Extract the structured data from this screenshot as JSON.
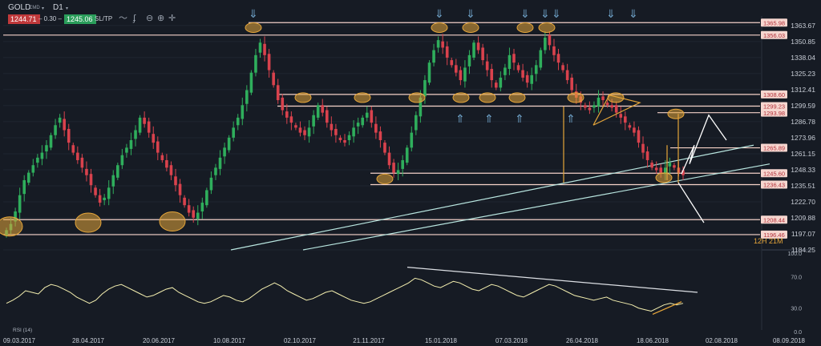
{
  "toolbar": {
    "symbol": "GOLD",
    "type": "CMD",
    "timeframe": "D1",
    "sell_price": "1244.71",
    "spread": "0.30",
    "buy_price": "1245.06",
    "sltp_label": "SL/TP"
  },
  "colors": {
    "background": "#161b24",
    "candle_up": "#2fae5c",
    "candle_down": "#d9424d",
    "level_line": "#f5d2c8",
    "trendline": "#b9e6e0",
    "rsi_line": "#f5f0b0",
    "annotation": "#e6a63a",
    "arrow_blue": "#6fa3c9"
  },
  "chart_data": [
    {
      "type": "candlestick",
      "title": "",
      "y_ticks": [
        "1363.67",
        "1350.85",
        "1338.04",
        "1325.23",
        "1312.41",
        "1299.59",
        "1286.78",
        "1273.96",
        "1261.15",
        "1248.33",
        "1235.51",
        "1222.70",
        "1209.88",
        "1197.07",
        "1184.25"
      ],
      "ylim": [
        1184.25,
        1370
      ],
      "x_ticks": [
        "09.03.2017",
        "28.04.2017",
        "20.06.2017",
        "10.08.2017",
        "02.10.2017",
        "21.11.2017",
        "15.01.2018",
        "07.03.2018",
        "26.04.2018",
        "18.06.2018",
        "02.08.2018",
        "08.09.2018"
      ],
      "level_labels": [
        "1365.98",
        "1356.03",
        "1308.60",
        "1299.23",
        "1293.98",
        "1265.89",
        "1245.60",
        "1236.43",
        "1208.44",
        "1196.46"
      ],
      "countdown": "12H 21M",
      "series_close": [
        1200,
        1205,
        1215,
        1228,
        1240,
        1246,
        1252,
        1258,
        1262,
        1268,
        1276,
        1284,
        1290,
        1280,
        1270,
        1262,
        1256,
        1250,
        1244,
        1236,
        1228,
        1222,
        1226,
        1234,
        1244,
        1252,
        1260,
        1266,
        1272,
        1280,
        1290,
        1285,
        1278,
        1270,
        1262,
        1256,
        1250,
        1244,
        1236,
        1228,
        1220,
        1214,
        1210,
        1214,
        1222,
        1232,
        1242,
        1250,
        1258,
        1266,
        1274,
        1282,
        1290,
        1300,
        1312,
        1326,
        1340,
        1350,
        1340,
        1328,
        1316,
        1304,
        1296,
        1290,
        1286,
        1282,
        1278,
        1276,
        1282,
        1292,
        1300,
        1294,
        1286,
        1280,
        1276,
        1272,
        1270,
        1276,
        1282,
        1286,
        1290,
        1294,
        1286,
        1278,
        1272,
        1262,
        1252,
        1246,
        1248,
        1256,
        1266,
        1278,
        1292,
        1306,
        1320,
        1334,
        1344,
        1352,
        1346,
        1338,
        1332,
        1326,
        1320,
        1330,
        1340,
        1350,
        1344,
        1336,
        1328,
        1320,
        1314,
        1322,
        1330,
        1340,
        1334,
        1328,
        1322,
        1318,
        1324,
        1332,
        1344,
        1354,
        1348,
        1340,
        1334,
        1328,
        1320,
        1312,
        1306,
        1302,
        1298,
        1296,
        1300,
        1306,
        1304,
        1300,
        1298,
        1294,
        1290,
        1286,
        1282,
        1278,
        1270,
        1262,
        1256,
        1250,
        1248,
        1246,
        1250,
        1254,
        1250,
        1246,
        1244
      ]
    },
    {
      "type": "line",
      "title": "",
      "indicator_label": "RSI (14)",
      "y_ticks": [
        "100.0",
        "70.0",
        "30.0",
        "0.0"
      ],
      "ylim": [
        0,
        100
      ],
      "values": [
        36,
        40,
        45,
        52,
        50,
        48,
        56,
        60,
        58,
        54,
        50,
        44,
        40,
        36,
        40,
        48,
        54,
        58,
        60,
        56,
        52,
        48,
        44,
        46,
        50,
        54,
        56,
        50,
        46,
        42,
        38,
        36,
        38,
        42,
        46,
        44,
        40,
        38,
        42,
        48,
        54,
        58,
        62,
        58,
        52,
        48,
        44,
        40,
        42,
        46,
        50,
        52,
        48,
        44,
        40,
        38,
        36,
        38,
        42,
        46,
        50,
        54,
        58,
        62,
        68,
        66,
        62,
        58,
        56,
        60,
        64,
        62,
        58,
        54,
        52,
        56,
        60,
        58,
        54,
        50,
        46,
        44,
        48,
        52,
        56,
        60,
        58,
        54,
        50,
        46,
        44,
        42,
        40,
        42,
        44,
        40,
        38,
        36,
        34,
        30,
        28,
        26,
        30,
        34,
        36,
        34,
        36
      ]
    }
  ]
}
